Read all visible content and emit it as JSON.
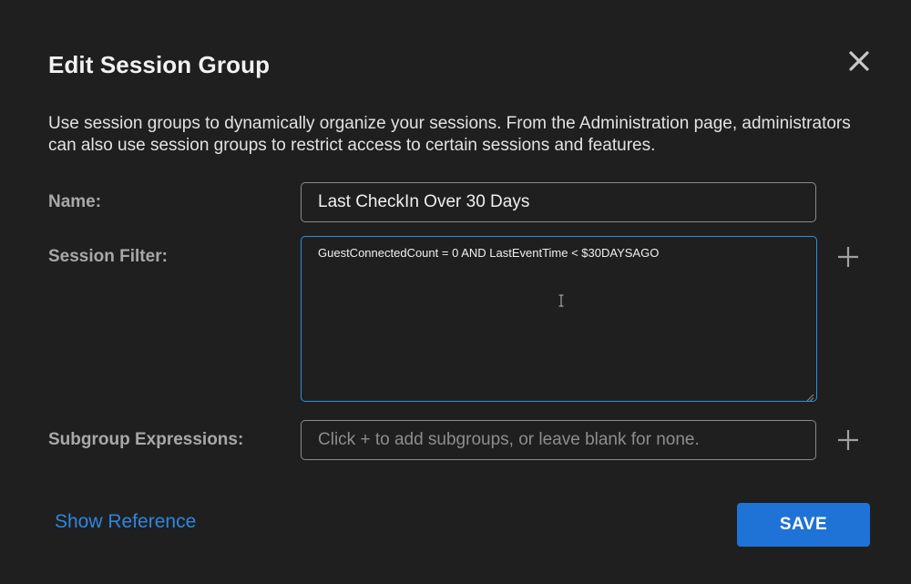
{
  "dialog": {
    "title": "Edit Session Group",
    "description": "Use session groups to dynamically organize your sessions. From the Administration page, administrators can also use session groups to restrict access to certain sessions and features.",
    "close_icon": "close-icon"
  },
  "fields": {
    "name": {
      "label": "Name:",
      "value": "Last CheckIn Over 30 Days"
    },
    "session_filter": {
      "label": "Session Filter:",
      "value": "GuestConnectedCount = 0 AND LastEventTime < $30DAYSAGO",
      "add_icon": "plus-icon"
    },
    "subgroup_expressions": {
      "label": "Subgroup Expressions:",
      "value": "",
      "placeholder": "Click + to add subgroups, or leave blank for none.",
      "add_icon": "plus-icon"
    }
  },
  "footer": {
    "show_reference_label": "Show Reference",
    "save_label": "SAVE"
  },
  "colors": {
    "background": "#1f1f1f",
    "accent": "#1f73d6",
    "link": "#2e86de",
    "focus_border": "#2f8fe0"
  }
}
